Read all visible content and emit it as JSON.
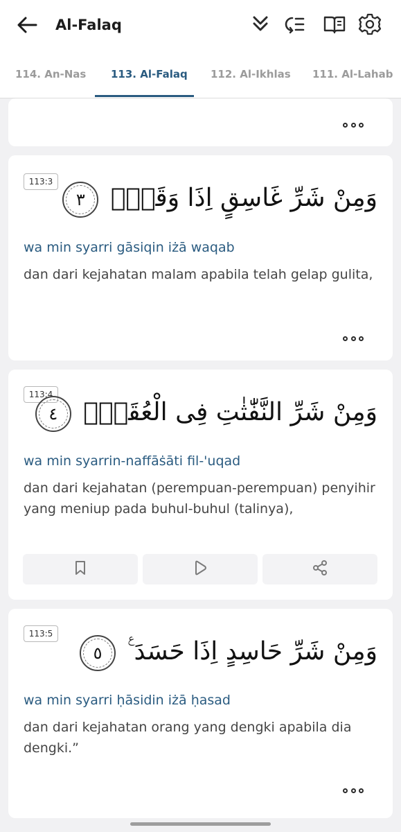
{
  "header": {
    "title": "Al-Falaq",
    "icons": [
      "back-arrow-icon",
      "double-chevron-down-icon",
      "playlist-icon",
      "book-icon",
      "gear-icon"
    ]
  },
  "tabs": [
    {
      "label": "114. An-Nas",
      "active": false
    },
    {
      "label": "113. Al-Falaq",
      "active": true
    },
    {
      "label": "112. Al-Ikhlas",
      "active": false
    },
    {
      "label": "111. Al-Lahab",
      "active": false
    }
  ],
  "verses": [
    {
      "ref": "113:3",
      "arabic": "وَمِنْ شَرِّ غَاسِقٍ اِذَا وَقَبَۙ",
      "number": "٣",
      "transliteration": "wa min syarri gāsiqin iżā waqab",
      "translation": "dan dari kejahatan malam apabila telah gelap gulita,"
    },
    {
      "ref": "113:4",
      "arabic": "وَمِنْ شَرِّ النَّفّٰثٰتِ فِى الْعُقَدِۙ",
      "number": "٤",
      "transliteration": "wa min syarrin-naffāṡāti fil-'uqad",
      "translation": "dan dari kejahatan (perempuan-perempuan) penyihir yang meniup pada buhul-buhul (talinya),"
    },
    {
      "ref": "113:5",
      "arabic": "وَمِنْ شَرِّ حَاسِدٍ اِذَا حَسَدَ ࣖ",
      "number": "٥",
      "transliteration": "wa min syarri ḥāsidin iżā ḥasad",
      "translation": "dan dari kejahatan orang yang dengki apabila dia dengki.”"
    }
  ],
  "actions": [
    "bookmark-icon",
    "play-icon",
    "share-icon"
  ],
  "colors": {
    "accent": "#2a5b80",
    "background": "#f1f1f3",
    "card": "#ffffff"
  }
}
